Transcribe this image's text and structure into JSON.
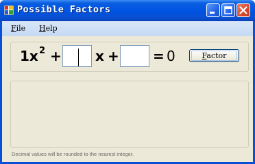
{
  "window": {
    "title": "Possible Factors",
    "icon": "app-icon",
    "controls": [
      "minimize-icon",
      "maximize-icon",
      "close-icon"
    ]
  },
  "menu": {
    "file": {
      "accel": "F",
      "rest": "ile"
    },
    "help": {
      "accel": "H",
      "rest": "elp"
    }
  },
  "equation": {
    "a_term": "1x",
    "exponent": "2",
    "plus1": "+",
    "b_value": "",
    "x": "x",
    "plus2": "+",
    "c_value": "",
    "equals": "=",
    "rhs": "0"
  },
  "factor_button": {
    "accel": "F",
    "rest": "actor"
  },
  "results": [],
  "note": "Decimal values will be rounded to the nearest integer.",
  "colors": {
    "titlebar": "#0054e3",
    "client": "#ece9d8",
    "close": "#d9472a"
  }
}
